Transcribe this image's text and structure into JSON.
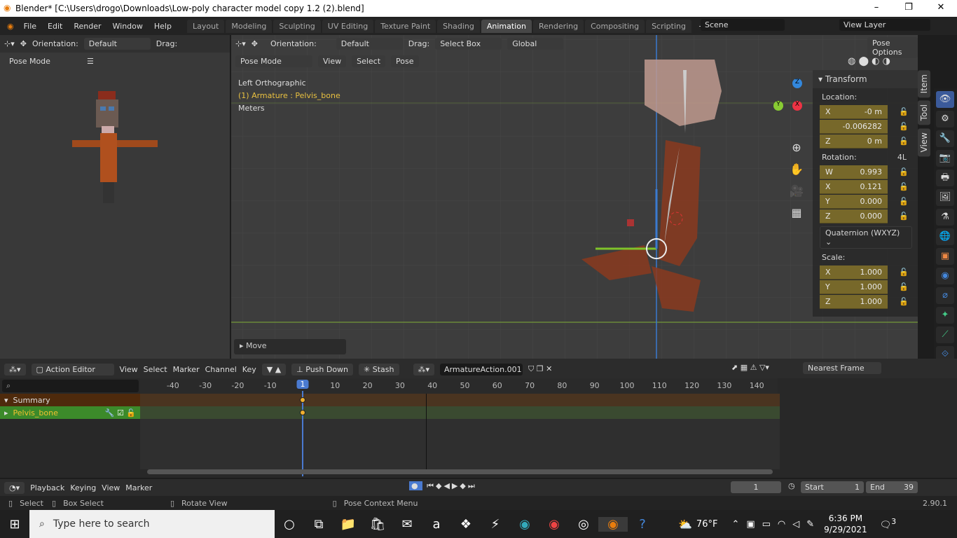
{
  "window": {
    "title": "Blender* [C:\\Users\\drogo\\Downloads\\Low-poly character model copy 1.2 (2).blend]",
    "min": "–",
    "max": "❐",
    "close": "✕"
  },
  "menu": [
    "File",
    "Edit",
    "Render",
    "Window",
    "Help"
  ],
  "workspaces": [
    "Layout",
    "Modeling",
    "Sculpting",
    "UV Editing",
    "Texture Paint",
    "Shading",
    "Animation",
    "Rendering",
    "Compositing",
    "Scripting"
  ],
  "active_workspace": "Animation",
  "scene": "Scene",
  "view_layer": "View Layer",
  "left_vp": {
    "orientation_label": "Orientation:",
    "orientation": "Default",
    "drag_label": "Drag:",
    "mode": "Pose Mode"
  },
  "main_vp": {
    "orientation_label": "Orientation:",
    "orientation": "Default",
    "drag_label": "Drag:",
    "drag": "Select Box",
    "transform": "Global",
    "pose_options": "Pose Options",
    "mode": "Pose Mode",
    "view": "View",
    "select": "Select",
    "pose": "Pose",
    "info_view": "Left Orthographic",
    "info_obj": "(1) Armature : Pelvis_bone",
    "info_units": "Meters",
    "move_panel": "Move",
    "gizmo": {
      "x": "X",
      "y": "Y",
      "z": "Z"
    }
  },
  "transform": {
    "title": "Transform",
    "location_label": "Location:",
    "location": [
      {
        "axis": "X",
        "value": "-0 m"
      },
      {
        "axis": "",
        "value": "-0.006282"
      },
      {
        "axis": "Z",
        "value": "0 m"
      }
    ],
    "rotation_label": "Rotation:",
    "rotation_mode_short": "4L",
    "rotation": [
      {
        "axis": "W",
        "value": "0.993"
      },
      {
        "axis": "X",
        "value": "0.121"
      },
      {
        "axis": "Y",
        "value": "0.000"
      },
      {
        "axis": "Z",
        "value": "0.000"
      }
    ],
    "rotation_mode": "Quaternion (WXYZ)",
    "scale_label": "Scale:",
    "scale": [
      {
        "axis": "X",
        "value": "1.000"
      },
      {
        "axis": "Y",
        "value": "1.000"
      },
      {
        "axis": "Z",
        "value": "1.000"
      }
    ]
  },
  "side_tabs": [
    "Item",
    "Tool",
    "View"
  ],
  "action_editor": {
    "mode": "Action Editor",
    "menus": [
      "View",
      "Select",
      "Marker",
      "Channel",
      "Key"
    ],
    "push_down": "Push Down",
    "stash": "Stash",
    "action": "ArmatureAction.001",
    "snap": "Nearest Frame",
    "ticks": [
      "-40",
      "-30",
      "-20",
      "-10",
      "1",
      "10",
      "20",
      "30",
      "40",
      "50",
      "60",
      "70",
      "80",
      "90",
      "100",
      "110",
      "120",
      "130",
      "140"
    ],
    "current_frame": "1",
    "channels": [
      {
        "name": "Summary"
      },
      {
        "name": "Pelvis_bone"
      }
    ]
  },
  "timeline": {
    "playback": "Playback",
    "keying": "Keying",
    "view": "View",
    "marker": "Marker",
    "frame": "1",
    "start_label": "Start",
    "start": "1",
    "end_label": "End",
    "end": "39"
  },
  "status": {
    "select": "Select",
    "box_select": "Box Select",
    "rotate_view": "Rotate View",
    "context": "Pose Context Menu",
    "version": "2.90.1"
  },
  "taskbar": {
    "search": "Type here to search",
    "weather": "76°F",
    "time": "6:36 PM",
    "date": "9/29/2021",
    "notif": "3"
  }
}
